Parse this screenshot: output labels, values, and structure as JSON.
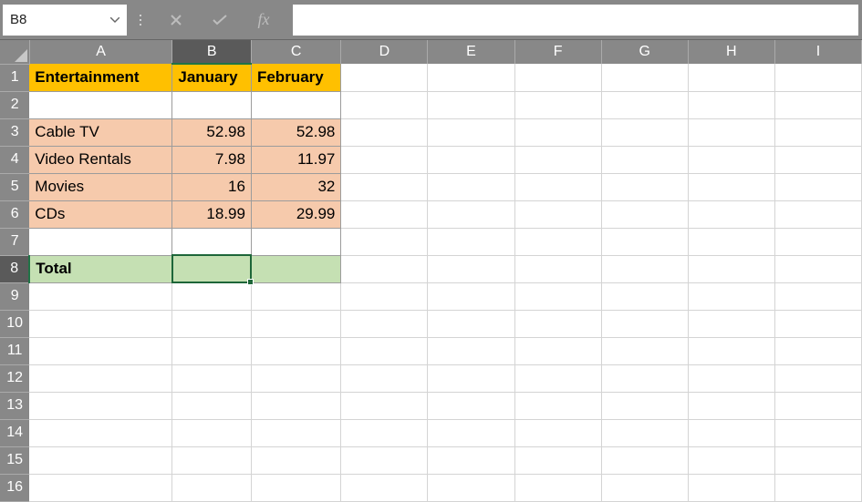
{
  "formula_bar": {
    "name_box_value": "B8",
    "cancel_icon": "✕",
    "confirm_icon": "✓",
    "fx_label": "fx",
    "formula_value": ""
  },
  "columns": [
    "A",
    "B",
    "C",
    "D",
    "E",
    "F",
    "G",
    "H",
    "I"
  ],
  "col_widths": {
    "A": 158,
    "B": 87,
    "C": 99,
    "D": 99,
    "E": 99,
    "F": 99,
    "G": 99,
    "H": 99,
    "I": 99
  },
  "row_count": 16,
  "selected_cell": {
    "row": 8,
    "col": "B"
  },
  "cells": {
    "A1": {
      "value": "Entertainment",
      "class": "hdr"
    },
    "B1": {
      "value": "January",
      "class": "hdr"
    },
    "C1": {
      "value": "February",
      "class": "hdr"
    },
    "A2": {
      "value": "",
      "class": "bordered-empty"
    },
    "B2": {
      "value": "",
      "class": "bordered-empty"
    },
    "C2": {
      "value": "",
      "class": "bordered-empty"
    },
    "A3": {
      "value": "Cable TV",
      "class": "peach"
    },
    "B3": {
      "value": "52.98",
      "class": "peach num"
    },
    "C3": {
      "value": "52.98",
      "class": "peach num"
    },
    "A4": {
      "value": "Video Rentals",
      "class": "peach"
    },
    "B4": {
      "value": "7.98",
      "class": "peach num"
    },
    "C4": {
      "value": "11.97",
      "class": "peach num"
    },
    "A5": {
      "value": "Movies",
      "class": "peach"
    },
    "B5": {
      "value": "16",
      "class": "peach num"
    },
    "C5": {
      "value": "32",
      "class": "peach num"
    },
    "A6": {
      "value": "CDs",
      "class": "peach"
    },
    "B6": {
      "value": "18.99",
      "class": "peach num"
    },
    "C6": {
      "value": "29.99",
      "class": "peach num"
    },
    "A7": {
      "value": "",
      "class": "bordered-empty"
    },
    "B7": {
      "value": "",
      "class": "bordered-empty"
    },
    "C7": {
      "value": "",
      "class": "bordered-empty"
    },
    "A8": {
      "value": "Total",
      "class": "green bold"
    },
    "B8": {
      "value": "",
      "class": "green"
    },
    "C8": {
      "value": "",
      "class": "green"
    }
  }
}
